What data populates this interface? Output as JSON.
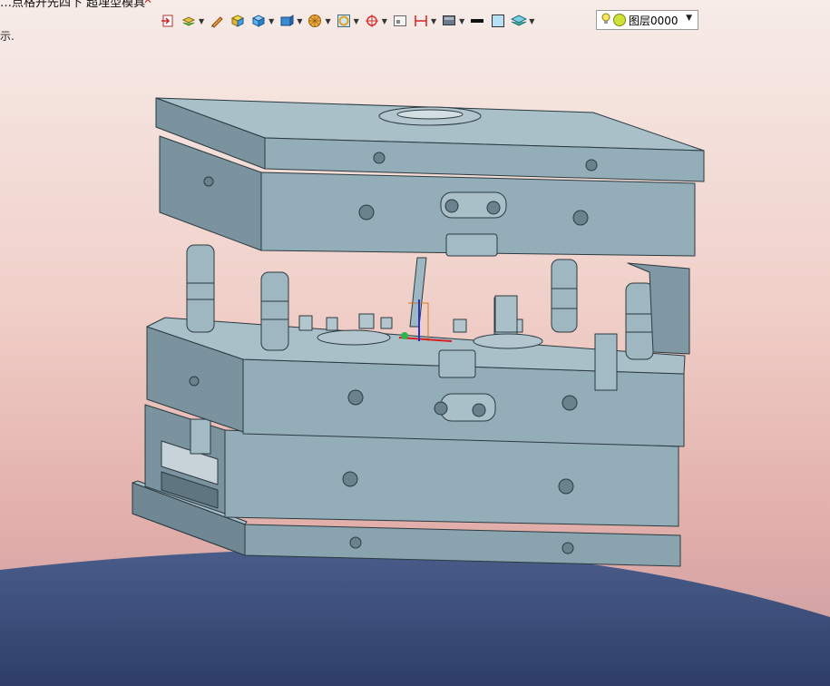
{
  "tab": {
    "title": "…点格开先四下 超埋型模具",
    "close_glyph": "✕"
  },
  "hint_text": "示.",
  "layer": {
    "name": "图层0000"
  },
  "toolbar": {
    "icons": [
      "import-icon",
      "layers-icon",
      "pen-icon",
      "box-yellow-icon",
      "box-blue-icon",
      "box-select-icon",
      "sphere-icon",
      "ring-icon",
      "target-icon",
      "view-icon",
      "dimension-icon",
      "display-icon",
      "line-color-icon",
      "fill-color-icon",
      "layer-manager-icon"
    ]
  },
  "colors": {
    "mold_face": "#94aeb9",
    "mold_side": "#7a939e",
    "mold_dark": "#5f7681",
    "edge": "#2b3a40",
    "sky_top": "#f6e6e0",
    "sky_bottom": "#e6b8b2",
    "hill": "#3c4f80"
  }
}
